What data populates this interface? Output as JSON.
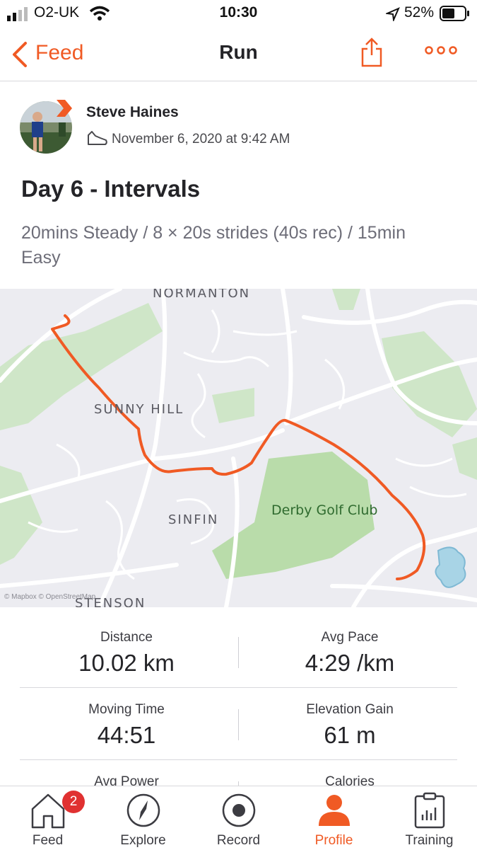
{
  "status_bar": {
    "carrier": "O2-UK",
    "time": "10:30",
    "battery": "52%"
  },
  "nav": {
    "back_label": "Feed",
    "title": "Run"
  },
  "activity": {
    "athlete_name": "Steve Haines",
    "date": "November 6, 2020 at 9:42 AM",
    "title": "Day 6 - Intervals",
    "description": "20mins Steady / 8 × 20s strides (40s rec) / 15min Easy"
  },
  "map": {
    "labels": {
      "normanton": "NORMANTON",
      "sunny_hill": "SUNNY HILL",
      "sinfin": "SINFIN",
      "stenson": "STENSON",
      "golf_club": "Derby Golf Club"
    },
    "attribution": "© Mapbox © OpenStreetMap",
    "route_color": "#f05a24"
  },
  "stats": [
    {
      "label": "Distance",
      "value": "10.02 km"
    },
    {
      "label": "Avg Pace",
      "value": "4:29 /km"
    },
    {
      "label": "Moving Time",
      "value": "44:51"
    },
    {
      "label": "Elevation Gain",
      "value": "61 m"
    },
    {
      "label": "Avg Power",
      "value": ""
    },
    {
      "label": "Calories",
      "value": ""
    }
  ],
  "tabs": [
    {
      "label": "Feed",
      "icon": "home-icon",
      "badge": "2",
      "active": false
    },
    {
      "label": "Explore",
      "icon": "compass-icon",
      "active": false
    },
    {
      "label": "Record",
      "icon": "record-icon",
      "active": false
    },
    {
      "label": "Profile",
      "icon": "profile-icon",
      "active": true
    },
    {
      "label": "Training",
      "icon": "training-icon",
      "active": false
    }
  ],
  "colors": {
    "accent": "#f05a24",
    "text": "#242428",
    "muted": "#6d6d78"
  }
}
